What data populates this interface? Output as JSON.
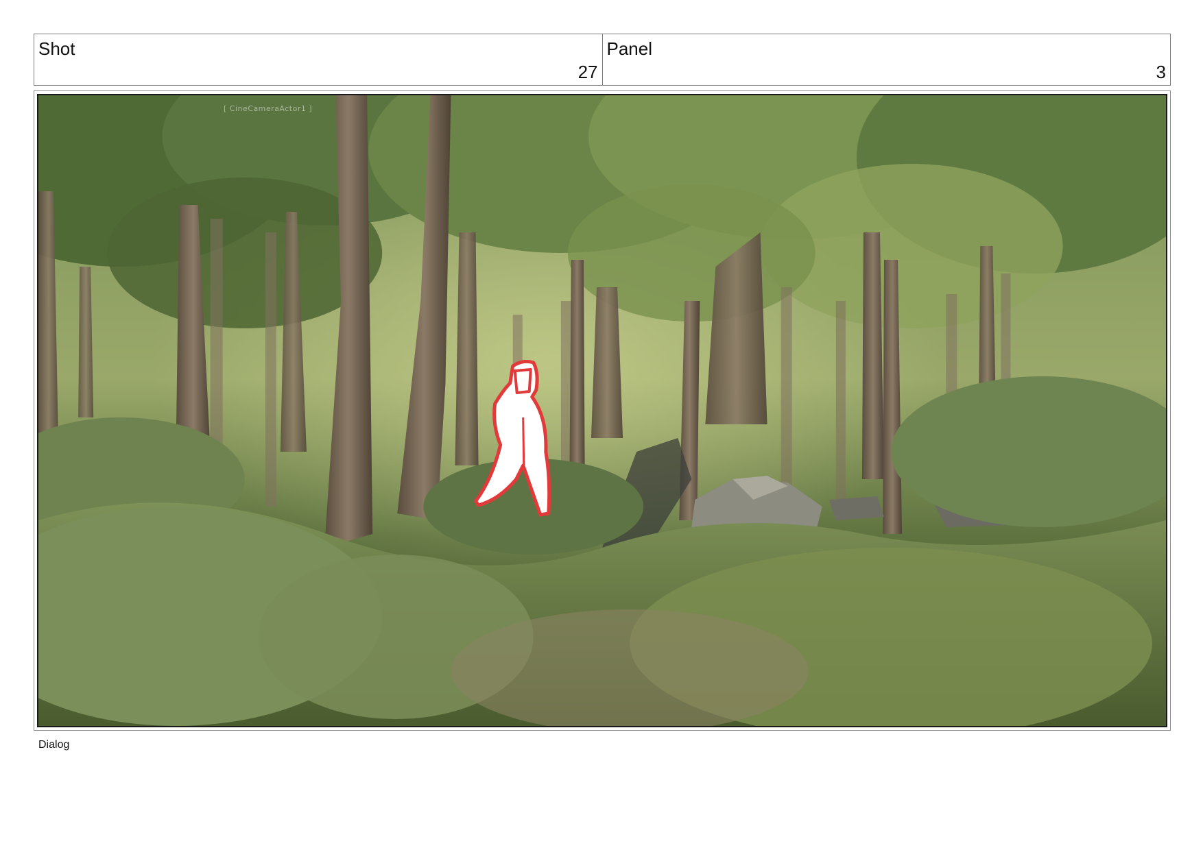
{
  "header": {
    "shot": {
      "label": "Shot",
      "value": "27"
    },
    "panel": {
      "label": "Panel",
      "value": "3"
    }
  },
  "frame": {
    "camera_overlay": "[ CineCameraActor1 ]",
    "figure_color": "#e23a3a"
  },
  "footer": {
    "dialog_label": "Dialog"
  }
}
